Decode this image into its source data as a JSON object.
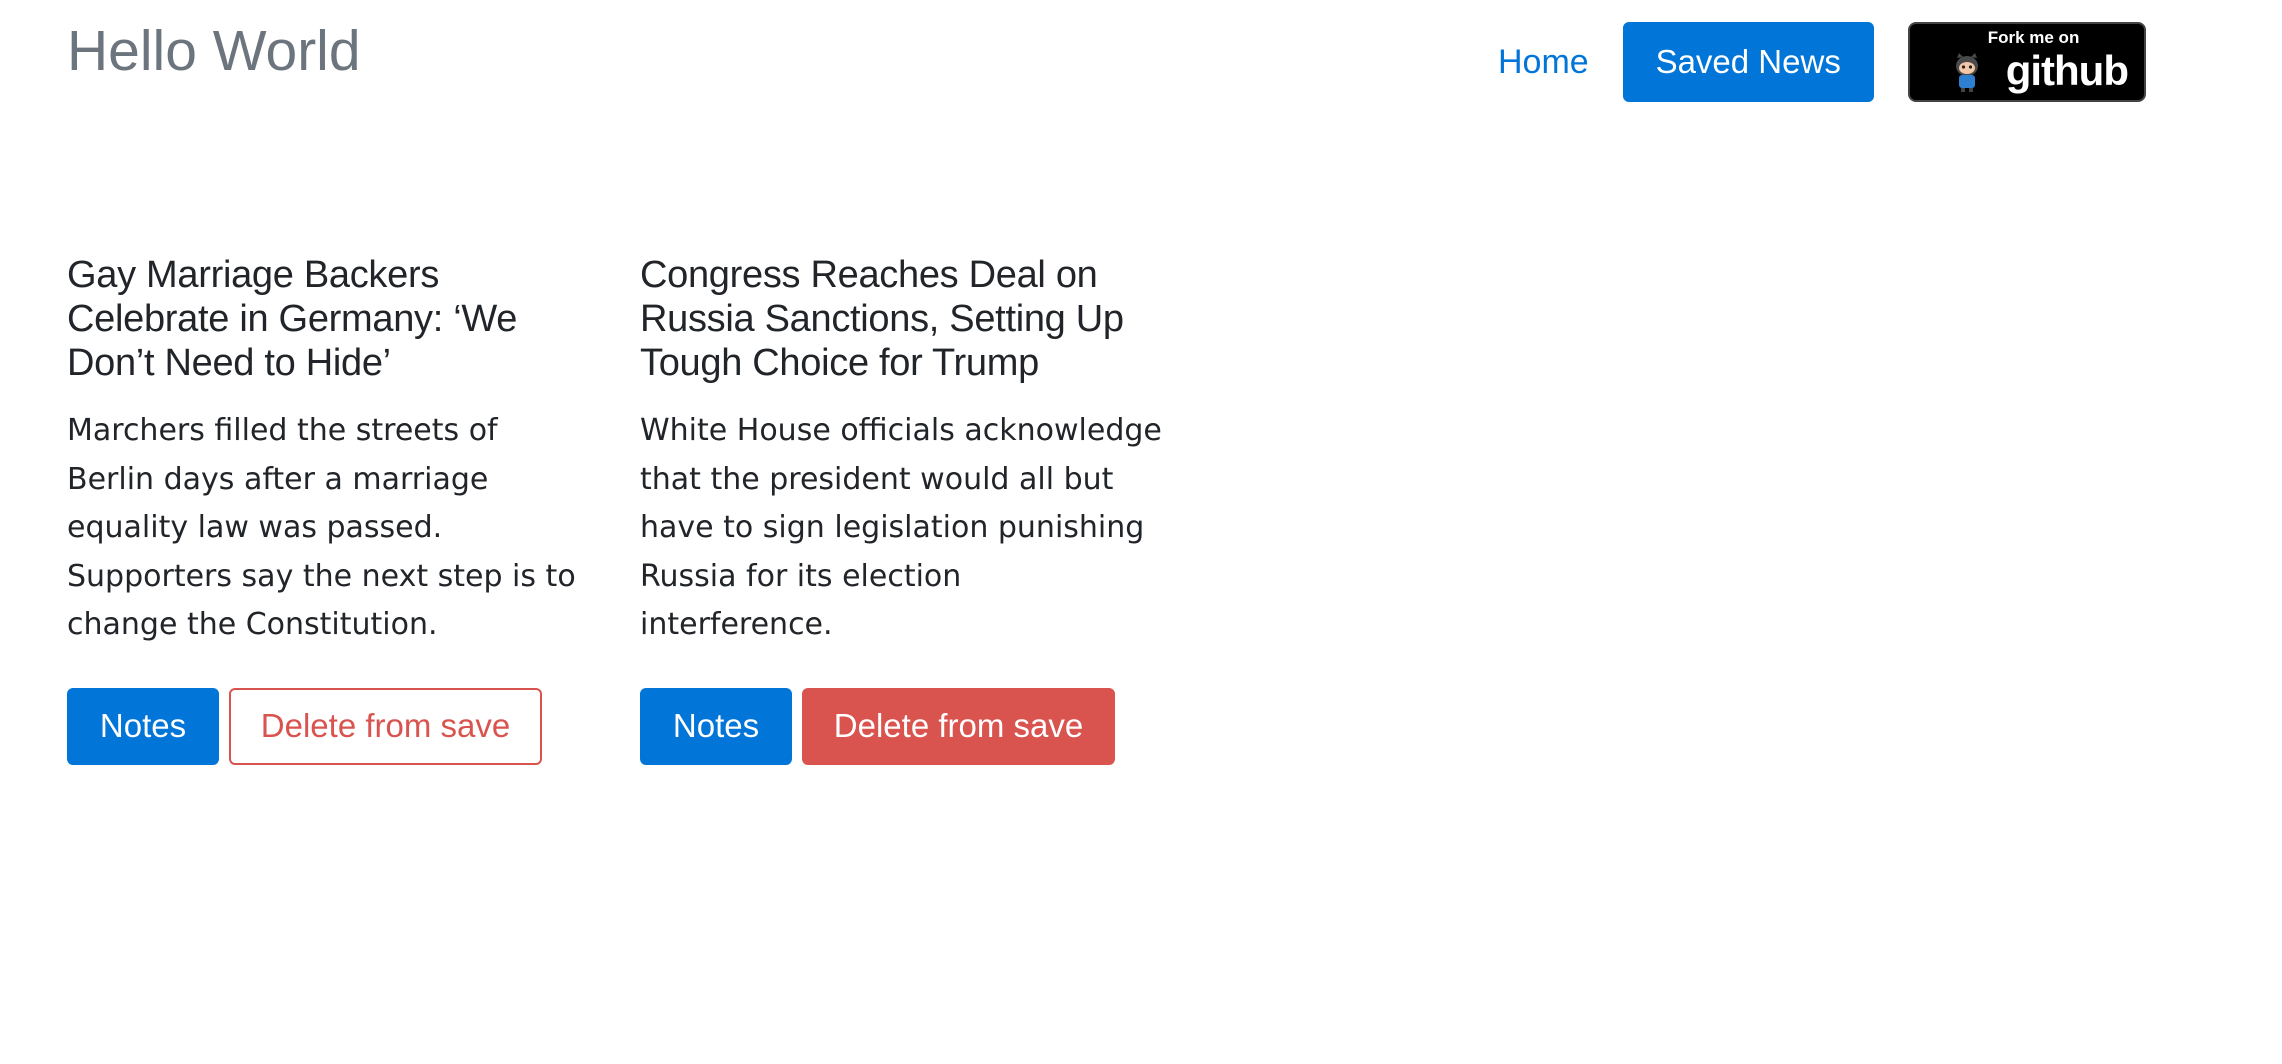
{
  "brand": "Hello World",
  "nav": {
    "home_label": "Home",
    "saved_news_label": "Saved News",
    "fork_badge": {
      "top_text": "Fork me on",
      "main_text": "github"
    }
  },
  "articles": [
    {
      "title": "Gay Marriage Backers Celebrate in Germany: ‘We Don’t Need to Hide’",
      "summary": "Marchers filled the streets of Berlin days after a marriage equality law was passed. Supporters say the next step is to change the Constitution.",
      "notes_label": "Notes",
      "delete_label": "Delete from save"
    },
    {
      "title": "Congress Reaches Deal on Russia Sanctions, Setting Up Tough Choice for Trump",
      "summary": "White House officials acknowledge that the president would all but have to sign legislation punishing Russia for its election interference.",
      "notes_label": "Notes",
      "delete_label": "Delete from save"
    }
  ],
  "colors": {
    "primary": "#0275d8",
    "danger": "#d9534f",
    "brand_text": "#6c757d",
    "body_text": "#212529"
  }
}
